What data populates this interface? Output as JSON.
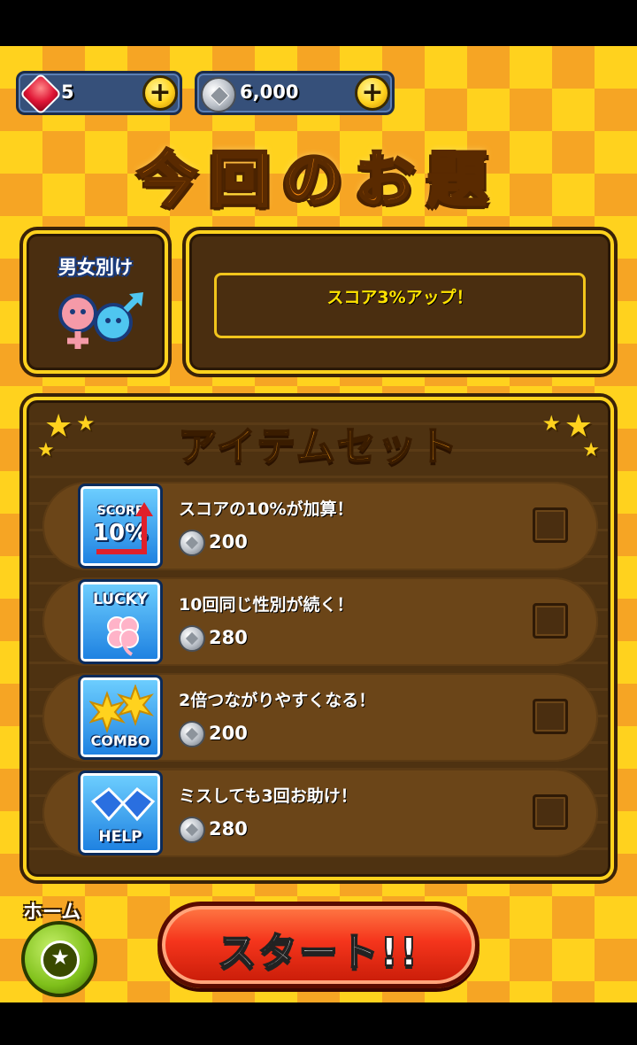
{
  "currency": {
    "gems": "5",
    "coins": "6,000"
  },
  "title": "今回のお題",
  "theme": {
    "name": "男女別け",
    "description": "スコア3%アップ！"
  },
  "items_panel": {
    "title": "アイテムセット",
    "items": [
      {
        "icon_top": "SCORE",
        "icon_bottom": "10%",
        "description": "スコアの10%が加算！",
        "cost": "200",
        "icon": "score-up-icon"
      },
      {
        "icon_top": "LUCKY",
        "icon_bottom": "",
        "description": "10回同じ性別が続く！",
        "cost": "280",
        "icon": "clover-icon"
      },
      {
        "icon_top": "",
        "icon_bottom": "COMBO",
        "description": "2倍つながりやすくなる！",
        "cost": "200",
        "icon": "combo-burst-icon"
      },
      {
        "icon_top": "",
        "icon_bottom": "HELP",
        "description": "ミスしても3回お助け！",
        "cost": "280",
        "icon": "handshake-icon"
      }
    ]
  },
  "home": {
    "label": "ホーム"
  },
  "start": {
    "label": "スタート!!"
  }
}
